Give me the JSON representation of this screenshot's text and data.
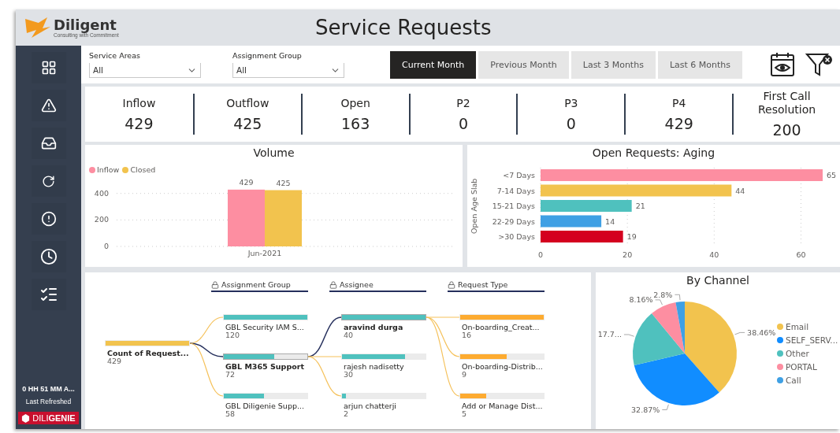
{
  "header": {
    "brand": "Diligent",
    "tagline": "Consulting with Commitment",
    "title": "Service Requests"
  },
  "sidebar": {
    "items": [
      {
        "kind": "grid"
      },
      {
        "kind": "alert"
      },
      {
        "kind": "inbox"
      },
      {
        "kind": "refresh"
      },
      {
        "kind": "info"
      },
      {
        "kind": "clock"
      },
      {
        "kind": "checklist"
      }
    ],
    "refresh_time": "0 HH 51 MM A...",
    "refresh_label": "Last Refreshed",
    "badge": "DILI**GENIE**"
  },
  "filters": [
    {
      "label": "Service Areas",
      "value": "All"
    },
    {
      "label": "Assignment Group",
      "value": "All"
    }
  ],
  "periods": [
    {
      "label": "Current Month",
      "selected": true
    },
    {
      "label": "Previous Month",
      "selected": false
    },
    {
      "label": "Last 3 Months",
      "selected": false
    },
    {
      "label": "Last 6 Months",
      "selected": false
    }
  ],
  "kpis": [
    {
      "label": "Inflow",
      "value": "429"
    },
    {
      "label": "Outflow",
      "value": "425"
    },
    {
      "label": "Open",
      "value": "163"
    },
    {
      "label": "P2",
      "value": "0"
    },
    {
      "label": "P3",
      "value": "0"
    },
    {
      "label": "P4",
      "value": "429"
    },
    {
      "label": "First Call Resolution",
      "value": "200"
    }
  ],
  "volume": {
    "chart_data": {
      "type": "bar",
      "title": "Volume",
      "categories": [
        "Jun-2021"
      ],
      "series": [
        {
          "name": "Inflow",
          "color": "#fd8ea1",
          "values": [
            429
          ]
        },
        {
          "name": "Closed",
          "color": "#f2c34e",
          "values": [
            425
          ]
        }
      ],
      "ylim": [
        0,
        440
      ],
      "yticks": [
        0,
        200,
        400
      ],
      "grid": true,
      "data_labels": true
    }
  },
  "aging": {
    "chart_data": {
      "type": "bar",
      "orientation": "horizontal",
      "title": "Open Requests: Aging",
      "ylabel": "Open Age Slab",
      "categories": [
        "<7 Days",
        "7-14 Days",
        "15-21 Days",
        "22-29 Days",
        ">30 Days"
      ],
      "series": [
        {
          "values": [
            65,
            44,
            21,
            14,
            19
          ]
        }
      ],
      "colors": [
        "#fd8ea1",
        "#f2c34e",
        "#4fc1be",
        "#3fa0e4",
        "#d4001f"
      ],
      "xlim": [
        0,
        65
      ],
      "xticks": [
        0,
        20,
        40,
        60
      ],
      "grid": true,
      "data_labels": true
    }
  },
  "decomposition": {
    "root": {
      "label": "Count of Request...",
      "value": "429",
      "level": 1
    },
    "columns": [
      {
        "header": "Assignment Group",
        "nodes": [
          {
            "label": "GBL Security IAM S...",
            "value": "120",
            "level": 1,
            "selected": false
          },
          {
            "label": "GBL M365 Support",
            "value": "72",
            "level": 0.6,
            "selected": true
          },
          {
            "label": "GBL Diligenie Supp...",
            "value": "58",
            "level": 0.48,
            "selected": false
          }
        ]
      },
      {
        "header": "Assignee",
        "nodes": [
          {
            "label": "aravind durga",
            "value": "40",
            "level": 1,
            "selected": true
          },
          {
            "label": "rajesh nadisetty",
            "value": "30",
            "level": 0.75,
            "selected": false
          },
          {
            "label": "arjun chatterji",
            "value": "2",
            "level": 0.05,
            "selected": false
          }
        ]
      },
      {
        "header": "Request Type",
        "nodes": [
          {
            "label": "On-boarding_Creat...",
            "value": "16",
            "level": 1,
            "selected": false
          },
          {
            "label": "On-boarding-Distrib...",
            "value": "9",
            "level": 0.56,
            "selected": false
          },
          {
            "label": "Add or Manage Dist...",
            "value": "5",
            "level": 0.31,
            "selected": false
          }
        ]
      }
    ]
  },
  "channel": {
    "chart_data": {
      "type": "pie",
      "title": "By Channel",
      "categories": [
        "Email",
        "SELF_SERV...",
        "Other",
        "PORTAL",
        "Call"
      ],
      "series": [
        {
          "values": [
            38.46,
            32.87,
            17.71,
            8.16,
            2.8
          ]
        }
      ],
      "colors": [
        "#f2c34e",
        "#118dff",
        "#4fc1be",
        "#fd8ea1",
        "#3fa0e4"
      ],
      "value_labels": [
        "38.46%",
        "32.87%",
        "17.7...",
        "8.16%",
        "2.8%"
      ]
    }
  }
}
